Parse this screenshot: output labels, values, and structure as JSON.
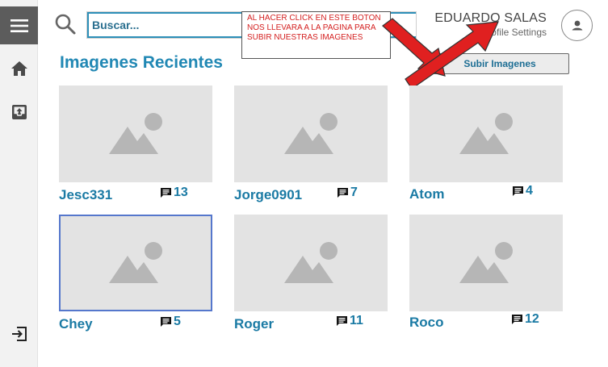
{
  "sidebar": {
    "icons": [
      "menu-icon",
      "home-icon",
      "inbox-upload-icon",
      "logout-icon"
    ]
  },
  "search": {
    "placeholder": "Buscar..."
  },
  "note": {
    "text": "AL HACER CLICK EN ESTE BOTON NOS LLEVARA A LA PAGINA PARA SUBIR NUESTRAS IMAGENES"
  },
  "user": {
    "name": "EDUARDO SALAS",
    "subtitle": "Profile Settings"
  },
  "main": {
    "title": "Imagenes Recientes",
    "upload_label": "Subir Imagenes"
  },
  "colors": {
    "accent": "#2188b4",
    "note_text": "#d42020",
    "arrow": "#e02020",
    "sidebar_active": "#5c5c5c"
  },
  "gallery": [
    {
      "name": "Jesc331",
      "count": "13"
    },
    {
      "name": "Jorge0901",
      "count": "7"
    },
    {
      "name": "Atom",
      "count": "4"
    },
    {
      "name": "Chey",
      "count": "5",
      "selected": true
    },
    {
      "name": "Roger",
      "count": "11"
    },
    {
      "name": "Roco",
      "count": "12"
    }
  ]
}
